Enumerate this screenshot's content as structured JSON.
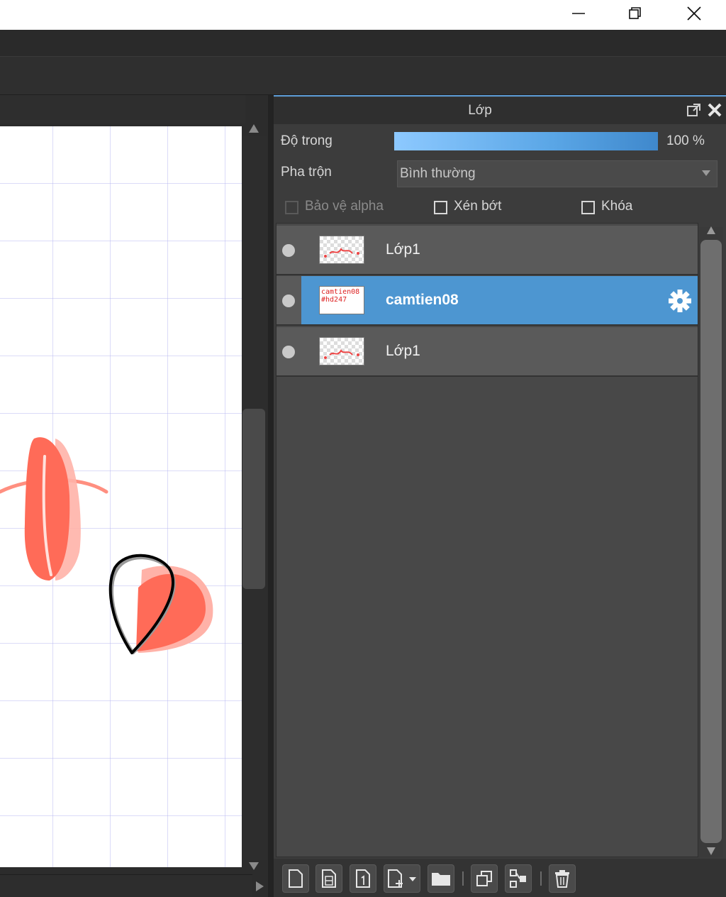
{
  "window": {
    "controls": {
      "minimize": "minimize-icon",
      "maximize": "restore-icon",
      "close": "close-icon"
    }
  },
  "layer_panel": {
    "title": "Lớp",
    "opacity": {
      "label": "Độ trong",
      "value": "100 %",
      "level": 1.0
    },
    "blend": {
      "label": "Pha trộn",
      "value": "Bình thường"
    },
    "checkboxes": [
      {
        "label": "Bảo vệ alpha",
        "checked": false,
        "enabled": false
      },
      {
        "label": "Xén bớt",
        "checked": false,
        "enabled": true
      },
      {
        "label": "Khóa",
        "checked": false,
        "enabled": true
      }
    ],
    "layers": [
      {
        "name": "Lớp1",
        "thumb_text": "",
        "selected": false
      },
      {
        "name": "camtien08",
        "thumb_text": "camtien08\n#hd247",
        "selected": true
      },
      {
        "name": "Lớp1",
        "thumb_text": "",
        "selected": false
      }
    ],
    "toolbar_icons": [
      "new-layer-icon",
      "new-8bit-layer-icon",
      "new-1bit-layer-icon",
      "add-layer-dropdown-icon",
      "folder-icon",
      "duplicate-icon",
      "merge-down-icon",
      "trash-icon"
    ]
  },
  "colors": {
    "accent": "#4d96d1",
    "stroke": "#ff6a55"
  }
}
